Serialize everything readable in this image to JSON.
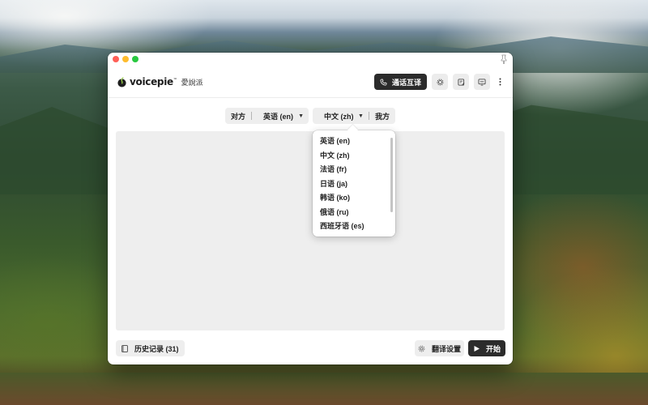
{
  "app": {
    "logo_text": "voicepie",
    "logo_tm": "™",
    "logo_cn": "愛說派"
  },
  "header": {
    "call_button_label": "通话互译",
    "icons": [
      "phone-icon",
      "settings-gear-icon",
      "notes-icon",
      "screen-subtitle-icon",
      "more-vertical-icon"
    ]
  },
  "language_bar": {
    "other_side_label": "对方",
    "other_side_language": "英语 (en)",
    "my_language": "中文 (zh)",
    "my_side_label": "我方"
  },
  "dropdown": {
    "options": [
      "英语 (en)",
      "中文 (zh)",
      "法语 (fr)",
      "日语 (ja)",
      "韩语 (ko)",
      "俄语 (ru)",
      "西班牙语 (es)"
    ]
  },
  "footer": {
    "history_label": "历史记录 (31)",
    "translate_settings_label": "翻译设置",
    "start_label": "开始"
  },
  "colors": {
    "dark_button": "#2b2b2b",
    "light_surface": "#eeeeee",
    "window_bg": "#ffffff"
  }
}
